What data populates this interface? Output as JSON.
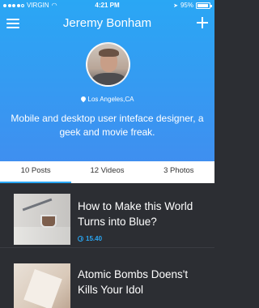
{
  "status": {
    "carrier": "VIRGIN",
    "time": "4:21 PM",
    "battery": "95%",
    "battery_level": 0.95
  },
  "nav": {
    "title": "Jeremy Bonham"
  },
  "profile": {
    "location": "Los Angeles,CA",
    "bio": "Mobile and desktop user inteface designer, a geek and movie freak."
  },
  "tabs": [
    {
      "label": "10 Posts",
      "active": true
    },
    {
      "label": "12 Videos",
      "active": false
    },
    {
      "label": "3 Photos",
      "active": false
    }
  ],
  "posts": [
    {
      "title": "How to Make this World Turns into Blue?",
      "time": "15.40"
    },
    {
      "title": "Atomic Bombs Doens't Kills Your Idol",
      "time": ""
    }
  ],
  "colors": {
    "accent": "#2aa7f4",
    "hero_top": "#2aa7f4",
    "hero_bottom": "#3f8ff0",
    "feed_bg": "#2c2e33"
  }
}
